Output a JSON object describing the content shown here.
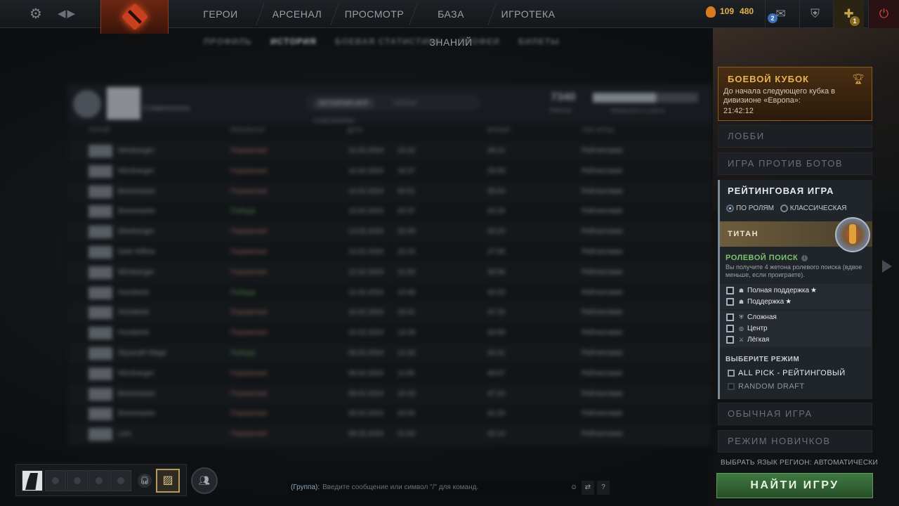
{
  "topbar": {
    "nav": [
      "ГЕРОИ",
      "АРСЕНАЛ",
      "ПРОСМОТР",
      "БАЗА ЗНАНИЙ",
      "ИГРОТЕКА"
    ],
    "shards": "109",
    "gold": "480",
    "messages_count": "2",
    "events_count": "1"
  },
  "subtabs": [
    "ПРОФИЛЬ",
    "ИСТОРИЯ",
    "БОЕВАЯ СТАТИСТИКА",
    "ТРОФЕИ",
    "БИЛЕТЫ"
  ],
  "history": {
    "player_name": "Славонсконь",
    "tabs": [
      "ИСТОРИЯ ИГР",
      "ГЕРОИ",
      "СОЮЗНИКИ"
    ],
    "score": "7340",
    "score_label": "Рейтинг",
    "bar_label": "Уверенность ранга",
    "bar_fill": 0.6,
    "columns": [
      "ГЕРОЙ",
      "РЕЗУЛЬТАТ",
      "ДАТА",
      "ВРЕМЯ",
      "ТИП ИГРЫ"
    ],
    "rows": [
      {
        "hero": "Windranger",
        "result": "Поражение",
        "date": "14.02.2024",
        "clock": "15:32",
        "duration": "49:21",
        "type": "Рейтинговая",
        "win": false
      },
      {
        "hero": "Windranger",
        "result": "Поражение",
        "date": "14.02.2024",
        "clock": "16:37",
        "duration": "29:59",
        "type": "Рейтинговая",
        "win": false
      },
      {
        "hero": "Brewmaster",
        "result": "Поражение",
        "date": "14.02.2024",
        "clock": "00:51",
        "duration": "35:04",
        "type": "Рейтинговая",
        "win": false
      },
      {
        "hero": "Brewmaster",
        "result": "Победа",
        "date": "13.02.2024",
        "clock": "20:37",
        "duration": "32:26",
        "type": "Рейтинговая",
        "win": true
      },
      {
        "hero": "Windranger",
        "result": "Поражение",
        "date": "13.02.2024",
        "clock": "23:49",
        "duration": "25:24",
        "type": "Рейтинговая",
        "win": false
      },
      {
        "hero": "Dark Willow",
        "result": "Поражение",
        "date": "13.02.2024",
        "clock": "22:24",
        "duration": "27:56",
        "type": "Рейтинговая",
        "win": false
      },
      {
        "hero": "Windranger",
        "result": "Поражение",
        "date": "12.02.2024",
        "clock": "21:53",
        "duration": "30:56",
        "type": "Рейтинговая",
        "win": false
      },
      {
        "hero": "Hoodwink",
        "result": "Победа",
        "date": "12.02.2024",
        "clock": "14:48",
        "duration": "43:20",
        "type": "Рейтинговая",
        "win": true
      },
      {
        "hero": "Hoodwink",
        "result": "Поражение",
        "date": "10.02.2024",
        "clock": "15:41",
        "duration": "47:15",
        "type": "Рейтинговая",
        "win": false
      },
      {
        "hero": "Hoodwink",
        "result": "Поражение",
        "date": "10.02.2024",
        "clock": "14:29",
        "duration": "34:05",
        "type": "Рейтинговая",
        "win": false
      },
      {
        "hero": "Skywrath Mage",
        "result": "Победа",
        "date": "09.02.2024",
        "clock": "12:33",
        "duration": "42:31",
        "type": "Рейтинговая",
        "win": true
      },
      {
        "hero": "Windranger",
        "result": "Поражение",
        "date": "09.02.2024",
        "clock": "11:06",
        "duration": "46:07",
        "type": "Рейтинговая",
        "win": false
      },
      {
        "hero": "Brewmaster",
        "result": "Поражение",
        "date": "09.02.2024",
        "clock": "10:33",
        "duration": "47:24",
        "type": "Рейтинговая",
        "win": false
      },
      {
        "hero": "Brewmaster",
        "result": "Поражение",
        "date": "09.02.2024",
        "clock": "20:45",
        "duration": "31:20",
        "type": "Рейтинговая",
        "win": false
      },
      {
        "hero": "Lion",
        "result": "Поражение",
        "date": "08.02.2024",
        "clock": "01:02",
        "duration": "42:14",
        "type": "Рейтинговая",
        "win": false
      }
    ]
  },
  "battle_cup": {
    "title": "БОЕВОЙ КУБОК",
    "text": "До начала следующего кубка в дивизионе «Европа»:",
    "time": "21:42:12"
  },
  "modes": {
    "lobby": "ЛОББИ",
    "bots": "ИГРА ПРОТИВ БОТОВ",
    "ranked_title": "РЕЙТИНГОВАЯ ИГРА",
    "by_roles": "ПО РОЛЯМ",
    "classic": "КЛАССИЧЕСКАЯ",
    "rank_name": "ТИТАН",
    "role_search_title": "РОЛЕВОЙ ПОИСК",
    "role_search_desc": "Вы получите 4 жетона ролевого поиска (вдвое меньше, если проиграете).",
    "roles_support": [
      {
        "label": "Полная поддержка",
        "star": "★"
      },
      {
        "label": "Поддержка",
        "star": "★"
      }
    ],
    "roles_core": [
      {
        "label": "Сложная"
      },
      {
        "label": "Центр"
      },
      {
        "label": "Лёгкая"
      }
    ],
    "choose_mode": "ВЫБЕРИТЕ РЕЖИМ",
    "game_modes": [
      "ALL PICK - РЕЙТИНГОВЫЙ",
      "RANDOM DRAFT"
    ],
    "normal": "ОБЫЧНАЯ ИГРА",
    "newbie": "РЕЖИМ НОВИЧКОВ",
    "language": "ВЫБРАТЬ ЯЗЫК",
    "region": "РЕГИОН: АВТОМАТИЧЕСКИ",
    "find": "НАЙТИ ИГРУ"
  },
  "chat": {
    "who": "(Группа):",
    "placeholder": "Введите сообщение или символ \"/\" для команд."
  }
}
